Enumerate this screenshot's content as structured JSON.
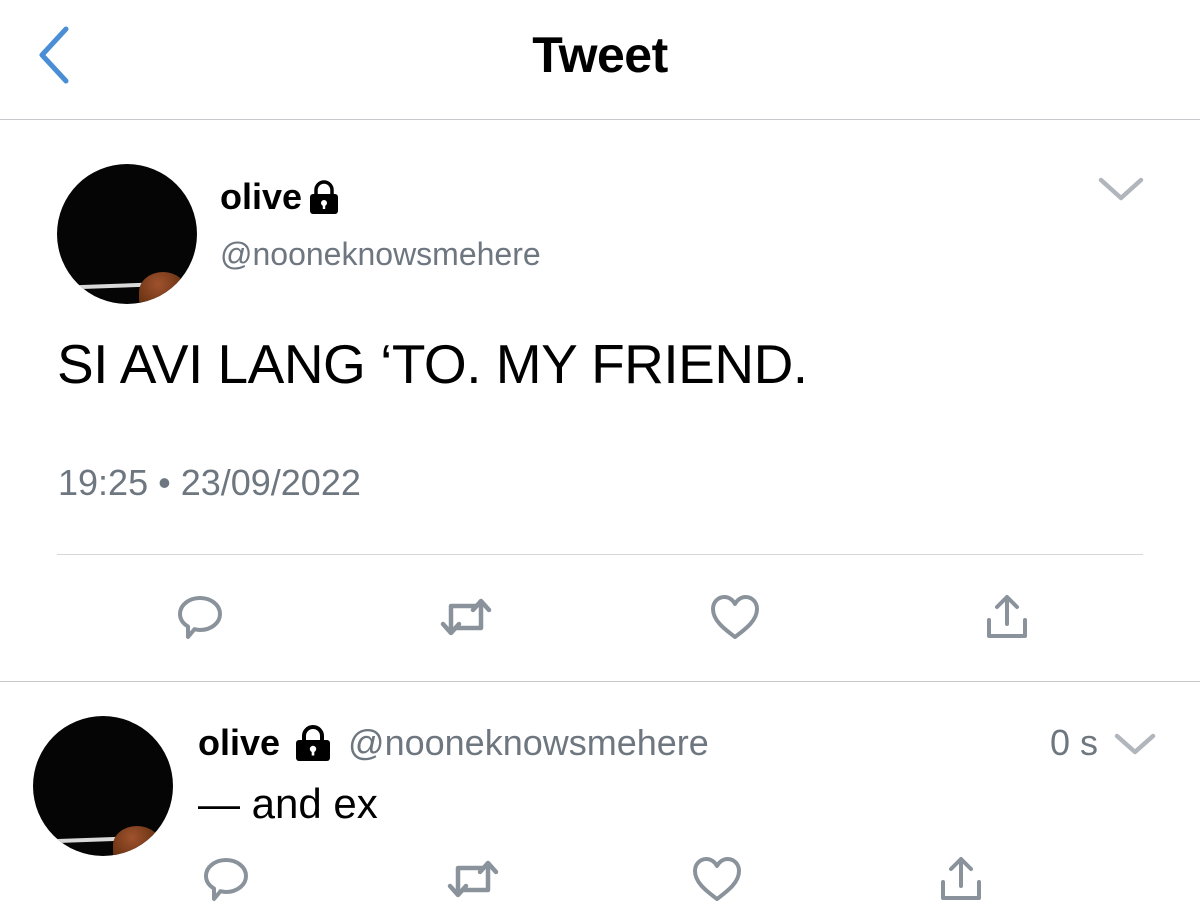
{
  "header": {
    "title": "Tweet",
    "back_icon": "chevron-left-icon"
  },
  "main_tweet": {
    "display_name": "olive",
    "protected_icon": "lock-icon",
    "handle": "@nooneknowsmehere",
    "text": "SI AVI LANG ‘TO. MY FRIEND.",
    "timestamp": "19:25 • 23/09/2022",
    "menu_icon": "chevron-down-icon",
    "actions": [
      "reply-icon",
      "retweet-icon",
      "like-icon",
      "share-icon"
    ]
  },
  "reply_tweet": {
    "display_name": "olive",
    "protected_icon": "lock-icon",
    "handle": "@nooneknowsmehere",
    "time": "0 s",
    "text": "— and ex",
    "menu_icon": "chevron-down-icon",
    "actions": [
      "reply-icon",
      "retweet-icon",
      "like-icon",
      "share-icon"
    ]
  },
  "colors": {
    "accent": "#4a8fd6",
    "secondary_text": "#6e7780",
    "icon_gray": "#8a939b",
    "divider": "#c8c8cc"
  }
}
